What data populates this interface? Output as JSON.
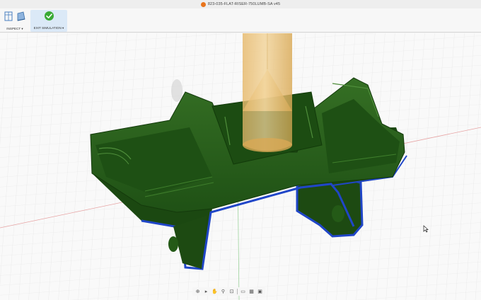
{
  "window": {
    "title": "823-035-FLAT-RISER-750LUMB-SA v45"
  },
  "ribbon": {
    "inspect": {
      "label": "INSPECT ▾",
      "icons": [
        "measure-icon",
        "section-analysis-icon"
      ]
    },
    "exit_simulation": {
      "label": "EXIT SIMULATION ▾",
      "icon": "checkmark-icon"
    }
  },
  "viewport": {
    "content": "simulation-part-with-tool",
    "colors": {
      "part": "#2e6b1f",
      "part_dark": "#1a4a11",
      "part_edge": "#2046c8",
      "tool": "#e8c27a",
      "grid": "#d9d9d9",
      "axis_x": "#e49a9a",
      "axis_y": "#9ad09a"
    }
  },
  "navbar": {
    "items": [
      "orbit-icon",
      "pan-icon",
      "hand-icon",
      "zoom-icon",
      "zoom-window-icon",
      "display-settings-icon",
      "grid-icon",
      "viewports-icon"
    ]
  },
  "colors": {
    "accent": "#2d7fd3",
    "exit_green": "#3aaa35"
  }
}
